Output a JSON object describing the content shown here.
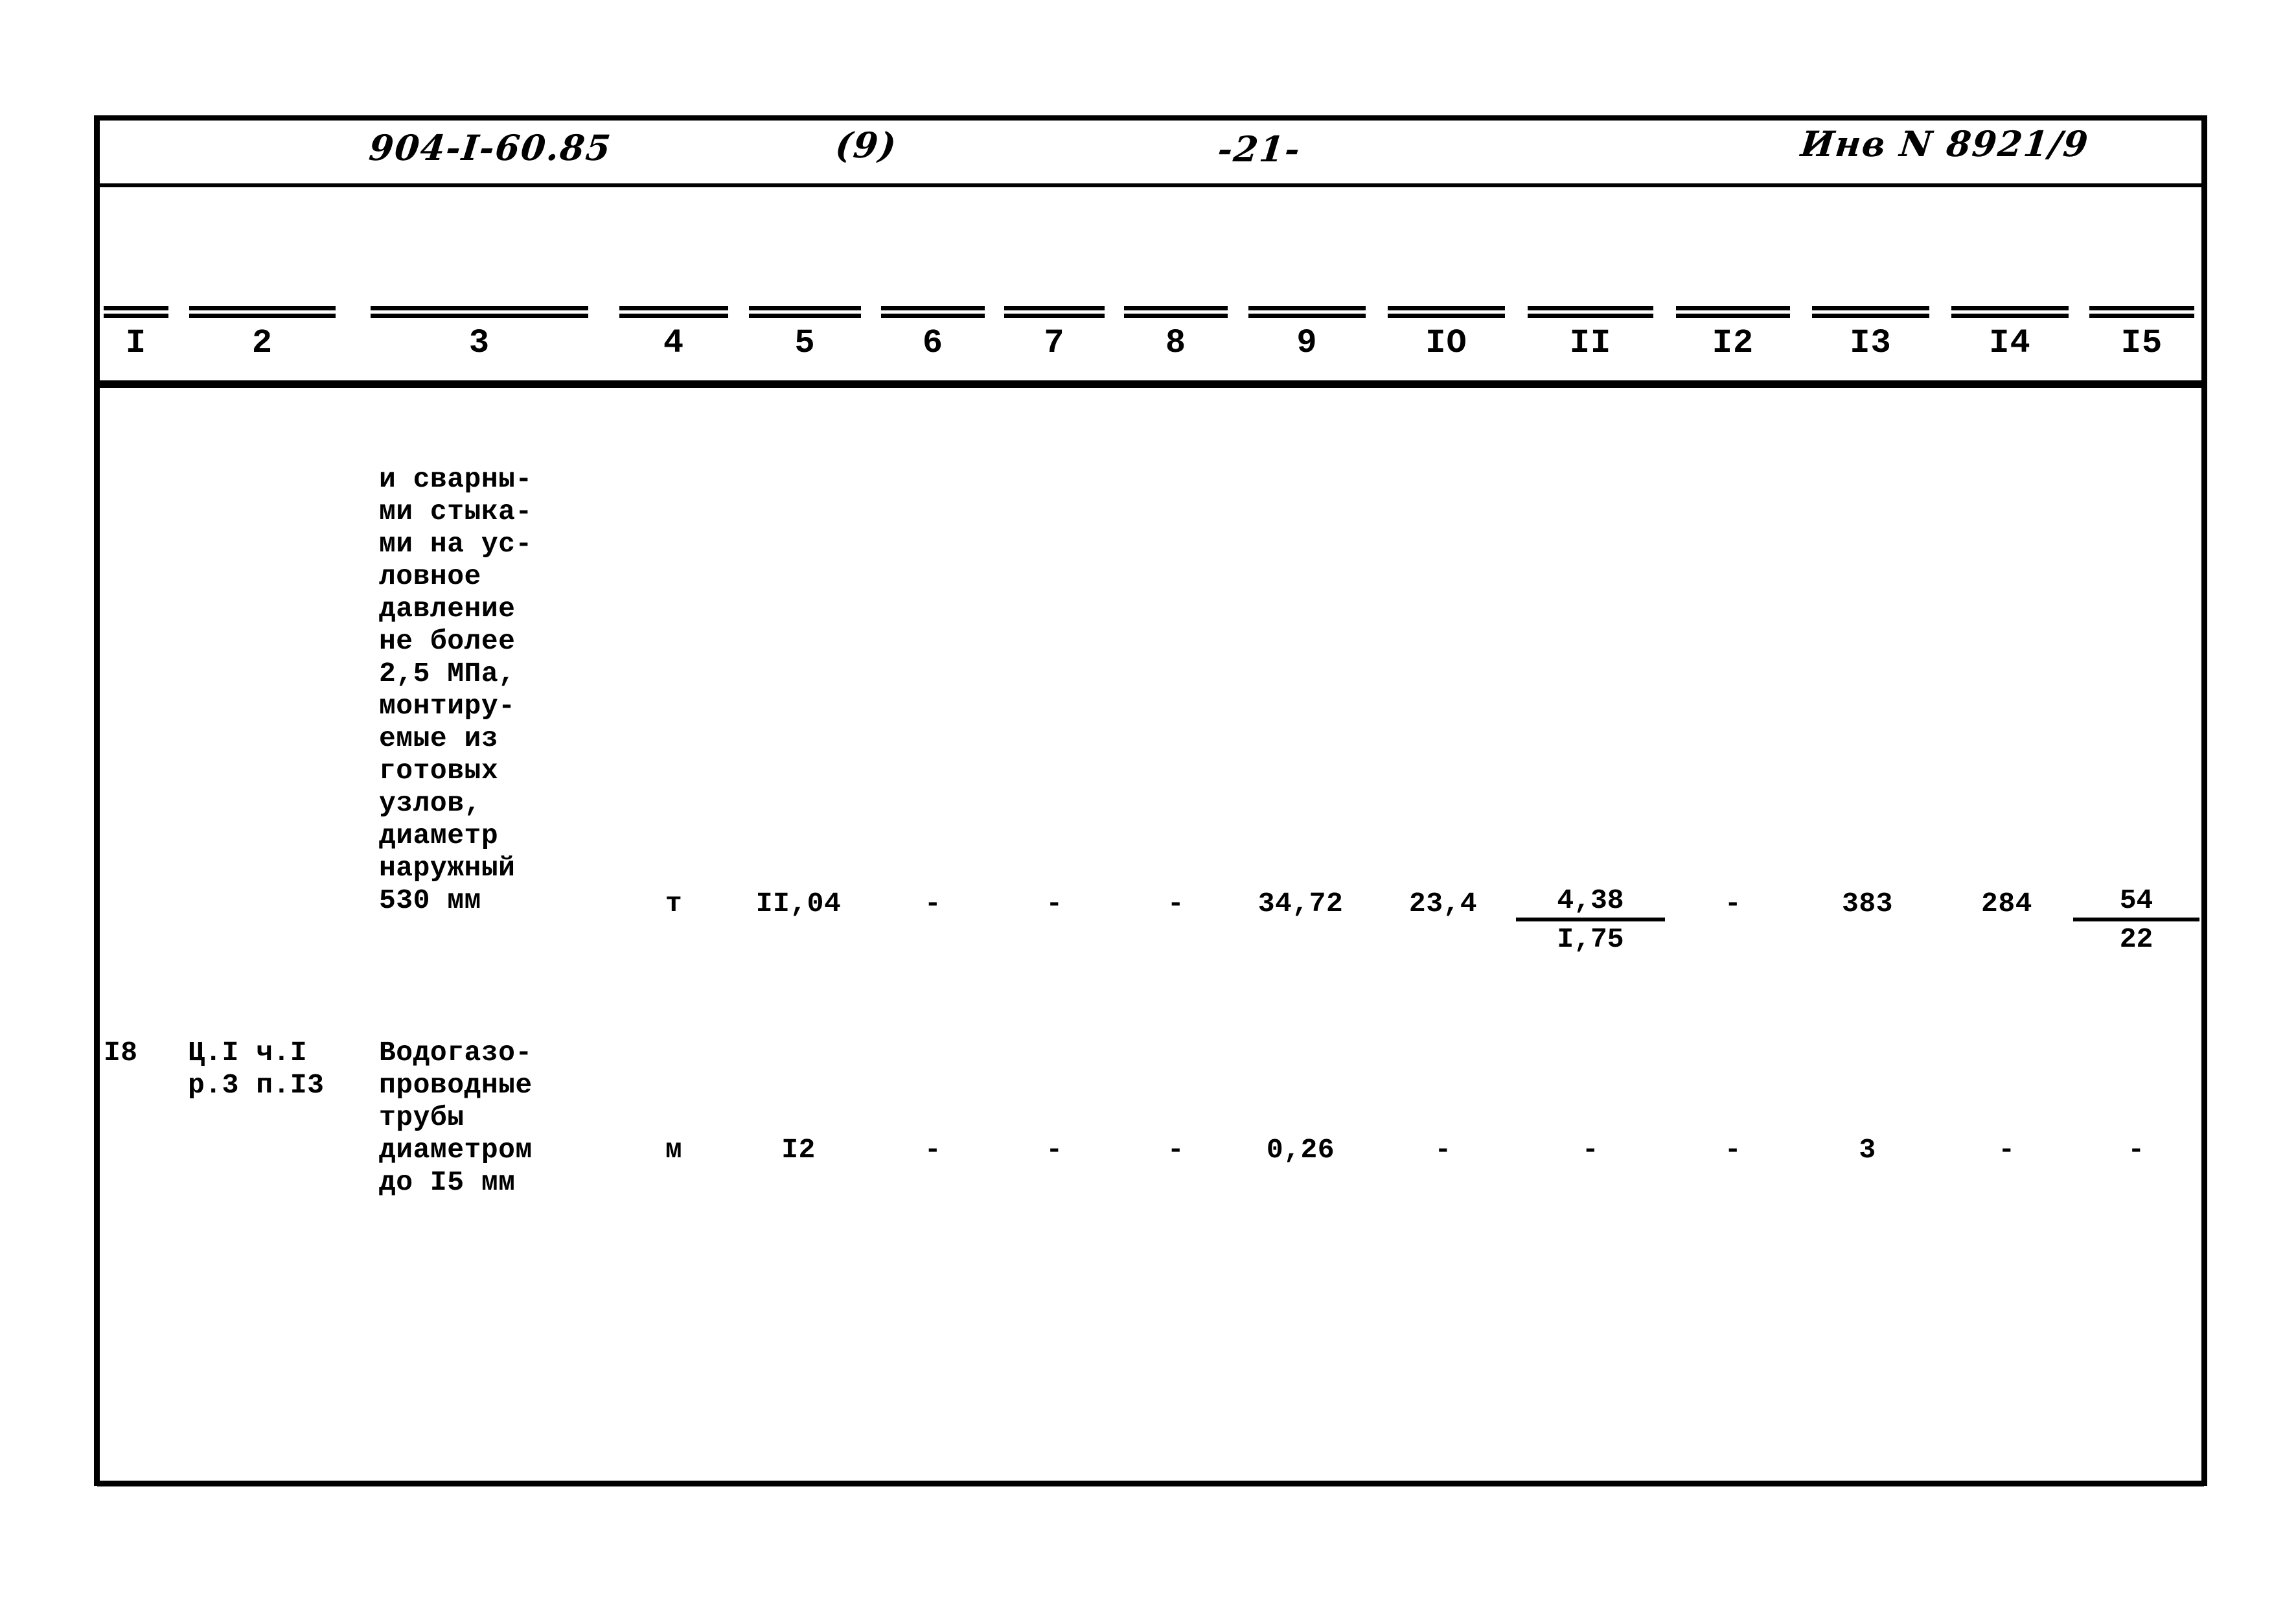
{
  "header": {
    "doc_code": "904-I-60.85",
    "sheet_marker": "(9)",
    "page_number": "-21-",
    "inventory_number": "Инв N 8921/9"
  },
  "table": {
    "column_numbers": [
      "I",
      "2",
      "3",
      "4",
      "5",
      "6",
      "7",
      "8",
      "9",
      "IO",
      "II",
      "I2",
      "I3",
      "I4",
      "I5"
    ],
    "rows": [
      {
        "id": "row-continued",
        "col1": "",
        "col2": "",
        "col3": "и сварны-\nми стыка-\nми на ус-\nловное\nдавление\nне более\n2,5 МПа,\nмонтиру-\nемые из\nготовых\nузлов,\nдиаметр\nнаружный\n530 мм",
        "col4": "т",
        "col5": "II,04",
        "col6": "-",
        "col7": "-",
        "col8": "-",
        "col9": "34,72",
        "col10": "23,4",
        "col11": {
          "numerator": "4,38",
          "denominator": "I,75"
        },
        "col12": "-",
        "col13": "383",
        "col14": "284",
        "col15": {
          "numerator": "54",
          "denominator": "22"
        }
      },
      {
        "id": "row-18",
        "col1": "I8",
        "col2": "Ц.I ч.I\nр.3 п.I3",
        "col3": "Водогазо-\nпроводные\nтрубы\nдиаметром\nдо I5 мм",
        "col4": "м",
        "col5": "I2",
        "col6": "-",
        "col7": "-",
        "col8": "-",
        "col9": "0,26",
        "col10": "-",
        "col11": "-",
        "col12": "-",
        "col13": "3",
        "col14": "-",
        "col15": "-"
      }
    ]
  }
}
